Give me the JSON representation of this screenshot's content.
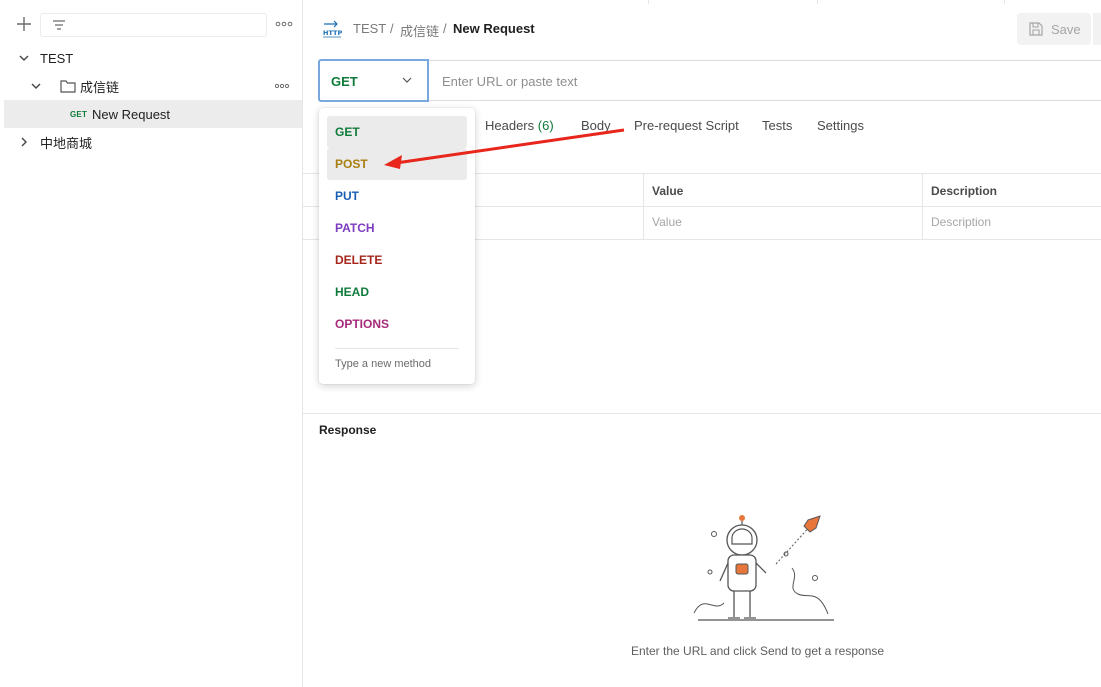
{
  "sidebar": {
    "tree": [
      {
        "label": "TEST"
      },
      {
        "label": "成信链"
      },
      {
        "label": "New Request",
        "method": "GET"
      },
      {
        "label": "中地商城"
      }
    ]
  },
  "header": {
    "breadcrumb": [
      "TEST",
      "/",
      "成信链",
      "/",
      "New Request"
    ],
    "save_label": "Save"
  },
  "request": {
    "method": "GET",
    "url_placeholder": "Enter URL or paste text",
    "tabs": [
      {
        "label": "Headers",
        "count": "(6)"
      },
      {
        "label": "Body"
      },
      {
        "label": "Pre-request Script"
      },
      {
        "label": "Tests"
      },
      {
        "label": "Settings"
      }
    ]
  },
  "params_table": {
    "headers": [
      "Value",
      "Description"
    ],
    "placeholders": [
      "Value",
      "Description"
    ]
  },
  "method_dropdown": {
    "options": [
      {
        "label": "GET",
        "color": "#0f7b3a"
      },
      {
        "label": "POST",
        "color": "#a87f0e"
      },
      {
        "label": "PUT",
        "color": "#1a5fb4"
      },
      {
        "label": "PATCH",
        "color": "#7d3cbf"
      },
      {
        "label": "DELETE",
        "color": "#a6261b"
      },
      {
        "label": "HEAD",
        "color": "#0f7b3a"
      },
      {
        "label": "OPTIONS",
        "color": "#a62a7a"
      }
    ],
    "highlighted": [
      "GET",
      "POST"
    ],
    "new_method_placeholder": "Type a new method"
  },
  "response": {
    "title": "Response",
    "hint": "Enter the URL and click Send to get a response"
  }
}
